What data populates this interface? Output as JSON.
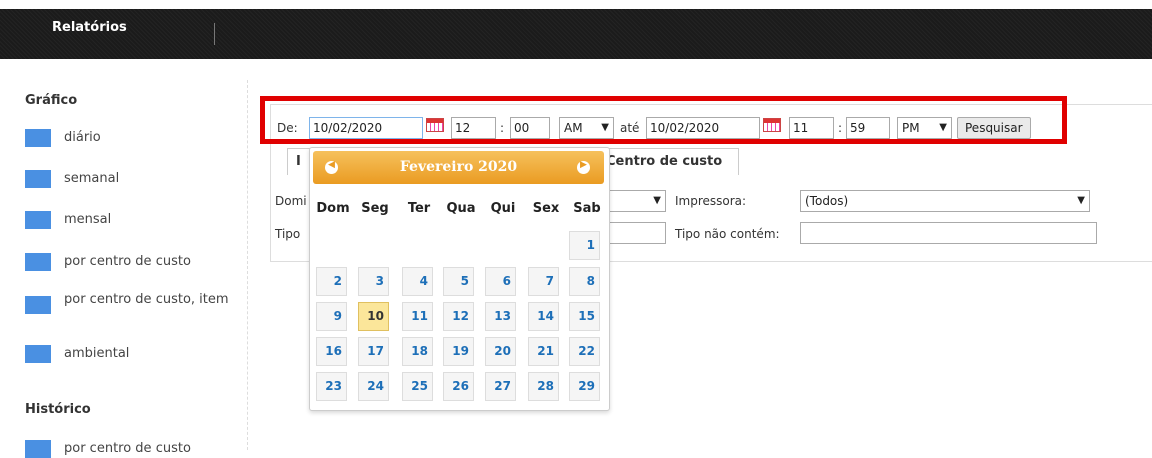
{
  "topbar": {
    "tab_label": "Relatórios"
  },
  "sidebar": {
    "section1_title": "Gráfico",
    "items": [
      {
        "label": "diário"
      },
      {
        "label": "semanal"
      },
      {
        "label": "mensal"
      },
      {
        "label": "por centro de custo"
      },
      {
        "label": "por centro de custo, item"
      },
      {
        "label": "ambiental"
      }
    ],
    "section2_title": "Histórico",
    "items2": [
      {
        "label": "por centro de custo"
      }
    ]
  },
  "filter": {
    "from_label": "De:",
    "from_date": "10/02/2020",
    "from_hour": "12",
    "colon": ":",
    "from_minute": "00",
    "from_ampm": "AM",
    "to_label": "até",
    "to_date": "10/02/2020",
    "to_hour": "11",
    "to_minute": "59",
    "to_ampm": "PM",
    "search_button": "Pesquisar"
  },
  "tabs": {
    "first": "I",
    "second": "Centro de custo"
  },
  "form": {
    "domain_label": "Domi",
    "type_label": "Tipo",
    "printer_label": "Impressora:",
    "printer_value": "(Todos)",
    "type_not_contains_label": "Tipo não contém:"
  },
  "calendar": {
    "title": "Fevereiro 2020",
    "days_of_week": [
      "Dom",
      "Seg",
      "Ter",
      "Qua",
      "Qui",
      "Sex",
      "Sab"
    ],
    "weeks": [
      [
        "",
        "",
        "",
        "",
        "",
        "",
        "1"
      ],
      [
        "2",
        "3",
        "4",
        "5",
        "6",
        "7",
        "8"
      ],
      [
        "9",
        "10",
        "11",
        "12",
        "13",
        "14",
        "15"
      ],
      [
        "16",
        "17",
        "18",
        "19",
        "20",
        "21",
        "22"
      ],
      [
        "23",
        "24",
        "25",
        "26",
        "27",
        "28",
        "29"
      ]
    ],
    "today": "10"
  },
  "colors": {
    "accent_blue": "#4a90e2",
    "highlight_red": "#e00000",
    "calendar_orange": "#f0a736",
    "today_yellow": "#fbe69a"
  }
}
